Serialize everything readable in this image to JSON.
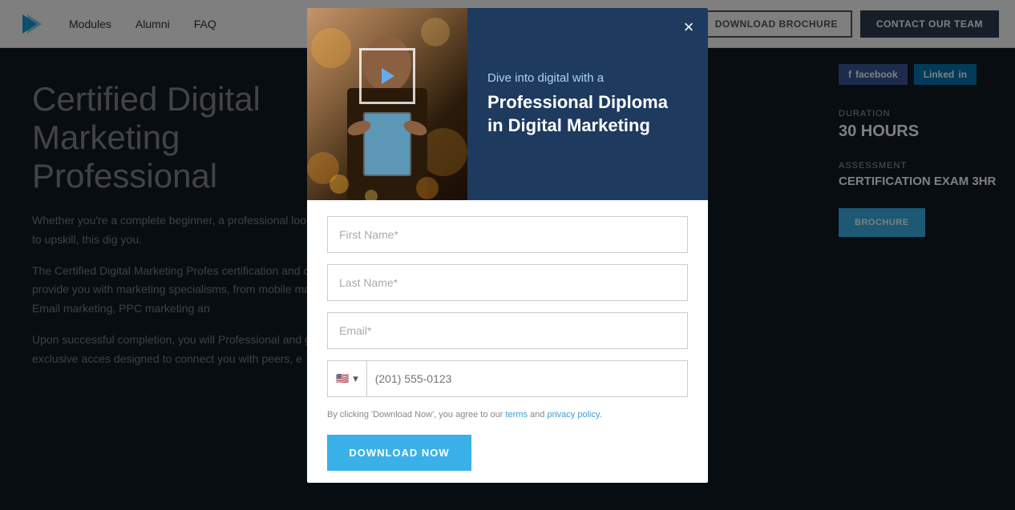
{
  "navbar": {
    "links": [
      {
        "label": "Modules",
        "id": "modules"
      },
      {
        "label": "Alumni",
        "id": "alumni"
      },
      {
        "label": "FAQ",
        "id": "faq"
      }
    ],
    "btn_download": "DOWNLOAD BROCHURE",
    "btn_contact": "CONTACT OUR TEAM"
  },
  "page": {
    "title": "Certified Digital\nMarketing\nProfessional",
    "para1": "Whether you're a complete beginner, a professional looking to upskill, this dig you.",
    "para2": "The Certified Digital Marketing Profes certification and can provide you with marketing specialisms, from mobile ma to Email marketing, PPC marketing an",
    "para3": "Upon successful completion, you will Professional and gain exclusive acces designed to connect you with peers, e"
  },
  "side_panel": {
    "duration_label": "DURATION",
    "duration_value": "30 HOURS",
    "assessment_label": "ASSESSMENT",
    "assessment_value": "CERTIFICATION EXAM 3HR",
    "btn_brochure": "BROCHURE"
  },
  "modal": {
    "close_label": "×",
    "header": {
      "subtitle": "Dive into digital with a",
      "title": "Professional Diploma in Digital Marketing"
    },
    "form": {
      "first_name_placeholder": "First Name*",
      "last_name_placeholder": "Last Name*",
      "email_placeholder": "Email*",
      "phone_placeholder": "(201) 555-0123",
      "phone_flag": "🇺🇸",
      "phone_dropdown": "▾",
      "disclaimer_prefix": "By clicking 'Download Now', you agree to our ",
      "disclaimer_terms": "terms",
      "disclaimer_middle": " and ",
      "disclaimer_privacy": "privacy policy",
      "disclaimer_suffix": ".",
      "btn_label": "DOWNLOAD NOW"
    }
  }
}
